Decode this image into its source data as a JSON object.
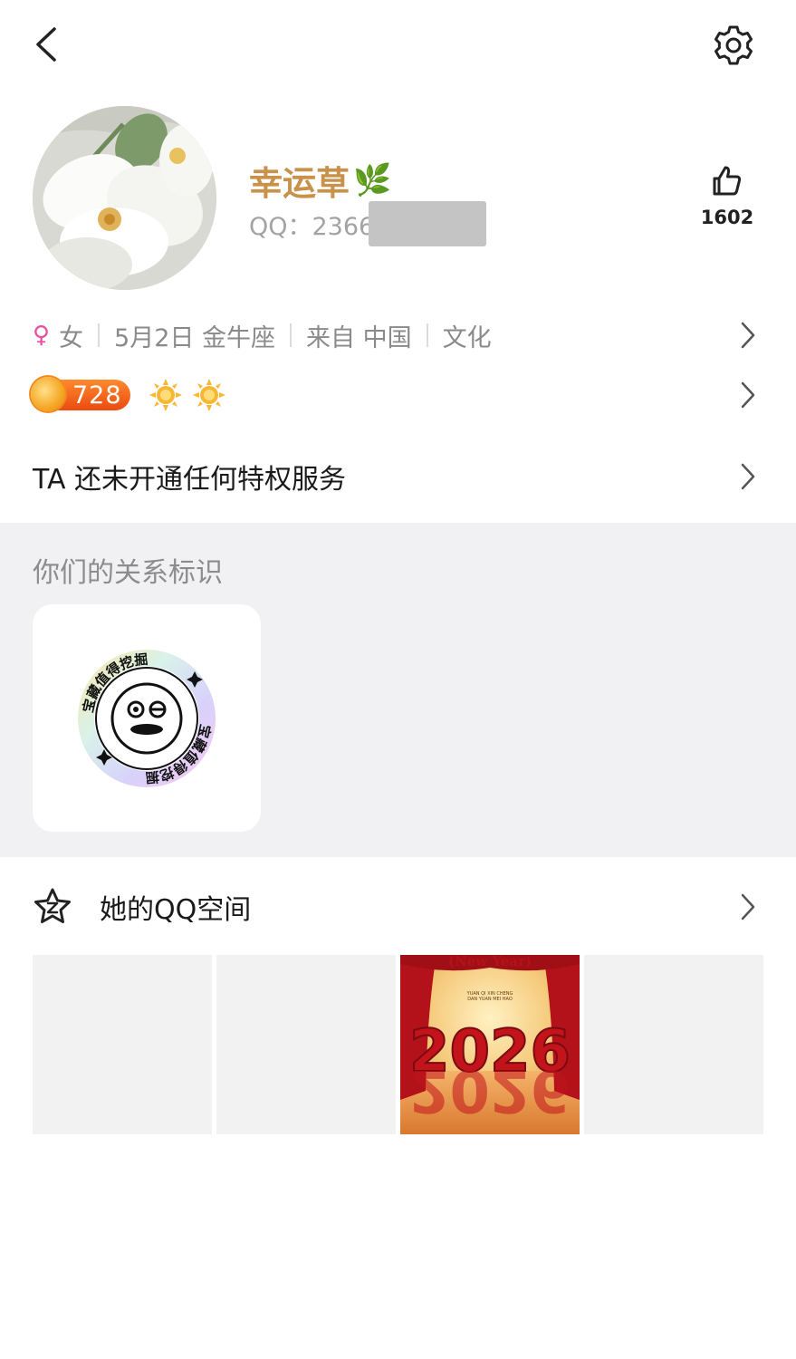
{
  "profile": {
    "nickname": "幸运草",
    "nickname_emoji": "🌿",
    "qq_prefix": "QQ：2366",
    "likes": "1602"
  },
  "info": {
    "gender_symbol": "♀",
    "gender": "女",
    "birthday": "5月2日 金牛座",
    "location": "来自 中国",
    "industry": "文化"
  },
  "badges": {
    "level_value": "728",
    "level_icon": "coin-icon",
    "extra_icons": [
      "sun-icon",
      "sun-icon"
    ]
  },
  "privilege": {
    "text": "TA 还未开通任何特权服务"
  },
  "relation": {
    "title": "你们的关系标识",
    "badge_text": "宝藏值得挖掘"
  },
  "qzone": {
    "label": "她的QQ空间",
    "photo3": {
      "title": "(New Year)",
      "subtitle_1": "YUAN QI XIN CHENG",
      "subtitle_2": "DAN YUAN MEI HAO",
      "year": "2026"
    }
  },
  "colors": {
    "nickname": "#c8924b",
    "gender": "#e94fa1",
    "section_bg": "#f1f1f3",
    "level_badge": "#ea4a10"
  }
}
